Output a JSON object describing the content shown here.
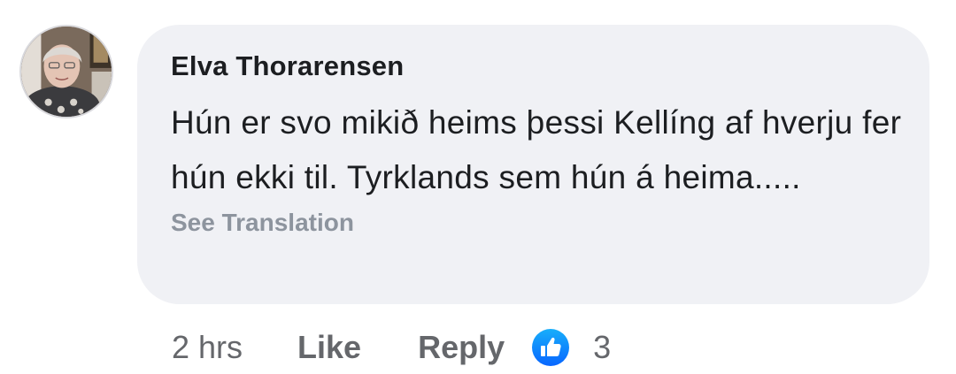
{
  "comment": {
    "author": "Elva Thorarensen",
    "text": "Hún er svo mikið heims þessi Kellíng af hverju fer hún ekki til. Tyrklands sem hún á heima.....",
    "see_translation": "See Translation"
  },
  "actions": {
    "time": "2 hrs",
    "like_label": "Like",
    "reply_label": "Reply",
    "reaction_icon": "like-thumb-icon",
    "reaction_count": "3"
  },
  "colors": {
    "bubble": "#f0f1f5",
    "name": "#1c1e21",
    "muted": "#65676b",
    "translation": "#8d949e",
    "like_blue": "#1877f2"
  }
}
